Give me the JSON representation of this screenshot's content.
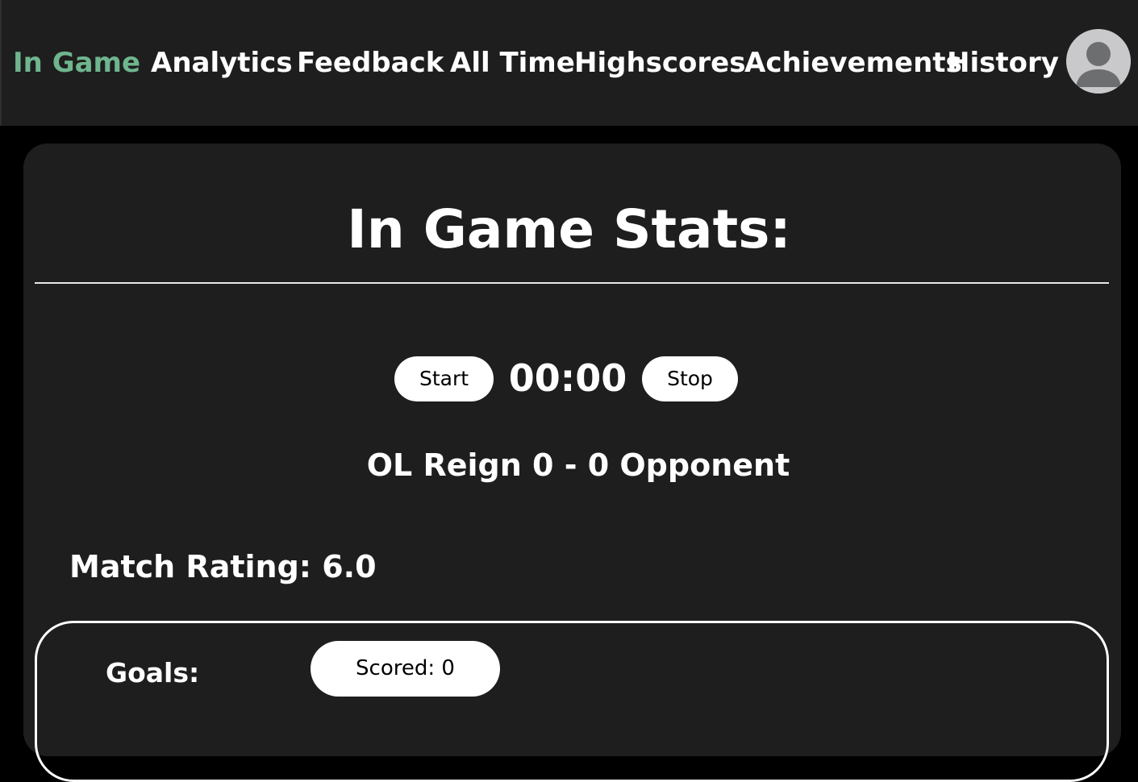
{
  "nav": {
    "items": [
      {
        "label": "In Game",
        "active": true
      },
      {
        "label": "Analytics",
        "active": false
      },
      {
        "label": "Feedback",
        "active": false
      },
      {
        "label": "All Time",
        "active": false
      },
      {
        "label": "Highscores",
        "active": false
      },
      {
        "label": "Achievements",
        "active": false
      },
      {
        "label": "History",
        "active": false
      }
    ],
    "avatar_icon": "user-avatar-icon"
  },
  "main": {
    "title": "In Game Stats:",
    "timer": {
      "start_label": "Start",
      "time": "00:00",
      "stop_label": "Stop"
    },
    "score": "OL Reign 0 - 0 Opponent",
    "match_rating": "Match Rating: 6.0",
    "goals": {
      "label": "Goals:",
      "scored_label": "Scored: 0"
    }
  },
  "colors": {
    "background": "#000000",
    "surface": "#1e1e1e",
    "accent_active_nav": "#6fb58e",
    "button_bg": "#ffffff",
    "button_text": "#000000",
    "avatar_bg": "#c9c9cb",
    "avatar_fg": "#6d6e70"
  }
}
